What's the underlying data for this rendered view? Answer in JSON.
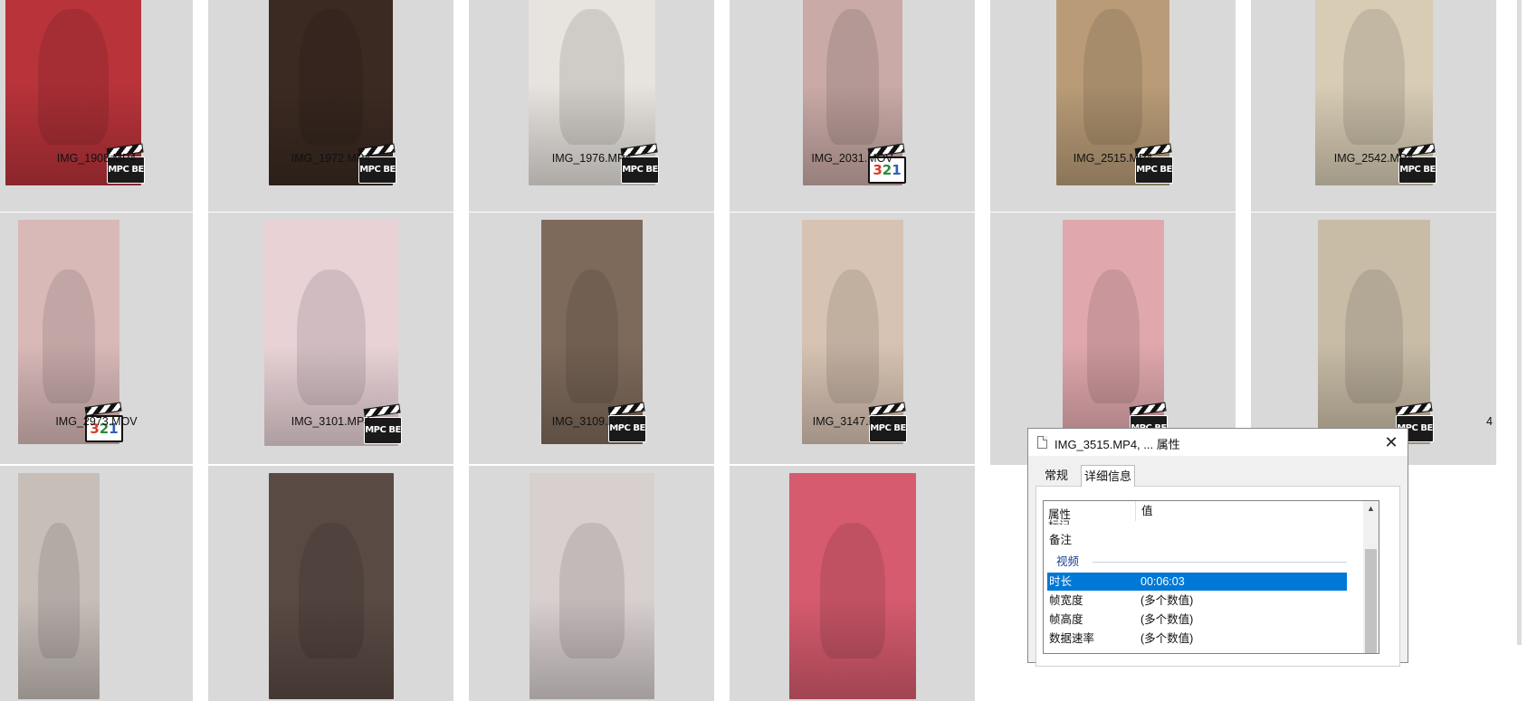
{
  "explorer": {
    "files": [
      {
        "name": "IMG_1908.MP4",
        "badge": "mpc",
        "color": "#b8333a"
      },
      {
        "name": "IMG_1972.MP4",
        "badge": "mpc",
        "color": "#3b2a22"
      },
      {
        "name": "IMG_1976.MP4",
        "badge": "mpc",
        "color": "#e7e3de"
      },
      {
        "name": "IMG_2031.MOV",
        "badge": "321",
        "color": "#c9aaa6"
      },
      {
        "name": "IMG_2515.MP4",
        "badge": "mpc",
        "color": "#b99c77"
      },
      {
        "name": "IMG_2542.MP4",
        "badge": "mpc",
        "color": "#d8ccb5"
      },
      {
        "name": "IMG_2973.MOV",
        "badge": "321",
        "color": "#d8b9b8"
      },
      {
        "name": "IMG_3101.MP4",
        "badge": "mpc",
        "color": "#e8d2d6"
      },
      {
        "name": "IMG_3109.MP4",
        "badge": "mpc",
        "color": "#7e6a5b"
      },
      {
        "name": "IMG_3147.MP4",
        "badge": "mpc",
        "color": "#d7c3b3"
      },
      {
        "name": "",
        "badge": "mpc",
        "color": "#e0a8ad"
      },
      {
        "name": "4",
        "badge": "mpc",
        "color": "#c8bca6"
      },
      {
        "name": "",
        "badge": "",
        "color": "#c7beb8"
      },
      {
        "name": "",
        "badge": "",
        "color": "#5a4a44"
      },
      {
        "name": "",
        "badge": "",
        "color": "#d8cfcf"
      },
      {
        "name": "",
        "badge": "",
        "color": "#d65b6e"
      }
    ],
    "badge_text": {
      "mpc": "MPC BE",
      "d1": "3",
      "d2": "2",
      "d3": "1"
    }
  },
  "dialog": {
    "title": "IMG_3515.MP4, ... 属性",
    "close_glyph": "✕",
    "tabs": {
      "general": "常规",
      "details": "详细信息"
    },
    "table": {
      "header_property": "属性",
      "header_value": "值",
      "cut_row": "标记",
      "rows": [
        {
          "key": "备注",
          "value": ""
        }
      ],
      "section_video": "视频",
      "video_rows": [
        {
          "key": "时长",
          "value": "00:06:03",
          "selected": true
        },
        {
          "key": "帧宽度",
          "value": "(多个数值)",
          "selected": false
        },
        {
          "key": "帧高度",
          "value": "(多个数值)",
          "selected": false
        },
        {
          "key": "数据速率",
          "value": "(多个数值)",
          "selected": false
        }
      ],
      "scroll_up_glyph": "▲"
    }
  }
}
